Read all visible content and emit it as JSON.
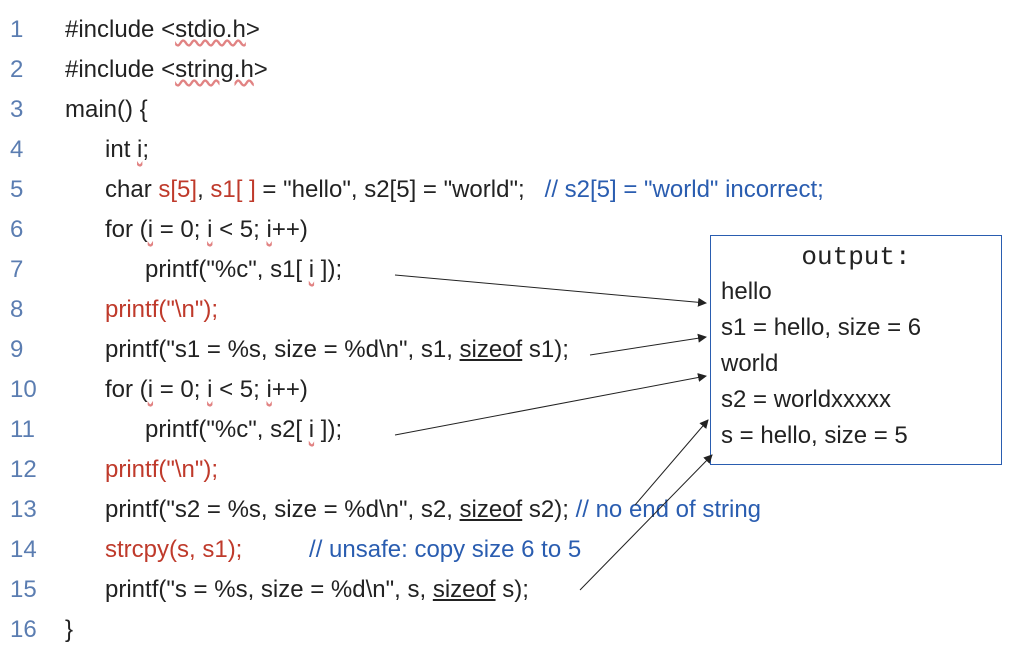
{
  "lineNumbers": [
    "1",
    "2",
    "3",
    "4",
    "5",
    "6",
    "7",
    "8",
    "9",
    "10",
    "11",
    "12",
    "13",
    "14",
    "15",
    "16"
  ],
  "code": {
    "l1a": "#include <",
    "l1b": "stdio.h",
    "l1c": ">",
    "l2a": "#include <",
    "l2b": "string.h",
    "l2c": ">",
    "l3": "main() {",
    "l4": "      int ",
    "l4b": "i",
    "l4c": ";",
    "l5a": "      char ",
    "l5b": "s[5]",
    "l5c": ", ",
    "l5d": "s1[ ]",
    "l5e": " = \"hello\", s2[5] = \"world\";   ",
    "l5comment": "// s2[5] = \"world\" incorrect;",
    "l6a": "      for (",
    "l6b": "i",
    "l6c": " = 0; ",
    "l6d": "i",
    "l6e": " < 5; ",
    "l6f": "i",
    "l6g": "++)",
    "l7a": "            printf(\"%c\", s1[ ",
    "l7b": "i",
    "l7c": " ]);",
    "l8": "      printf(\"\\n\");",
    "l9a": "      printf(\"s1 = %s, size = %d\\n\", s1, ",
    "l9b": "sizeof",
    "l9c": " s1);",
    "l10a": "      for (",
    "l10b": "i",
    "l10c": " = 0; ",
    "l10d": "i",
    "l10e": " < 5; ",
    "l10f": "i",
    "l10g": "++)",
    "l11a": "            printf(\"%c\", s2[ ",
    "l11b": "i",
    "l11c": " ]);",
    "l12": "      printf(\"\\n\");",
    "l13a": "      printf(\"s2 = %s, size = %d\\n\", s2, ",
    "l13b": "sizeof",
    "l13c": " s2); ",
    "l13comment": "// no end of string",
    "l14a": "      strcpy(s, s1);",
    "l14space": "          ",
    "l14comment": "// unsafe: copy size 6 to 5",
    "l15a": "      printf(\"s = %s, size = %d\\n\", s, ",
    "l15b": "sizeof",
    "l15c": " s);",
    "l16": "}"
  },
  "output": {
    "title": "output:",
    "lines": [
      "hello",
      "s1 = hello, size = 6",
      "world",
      "s2 = worldxxxxx",
      "s = hello, size = 5"
    ]
  }
}
